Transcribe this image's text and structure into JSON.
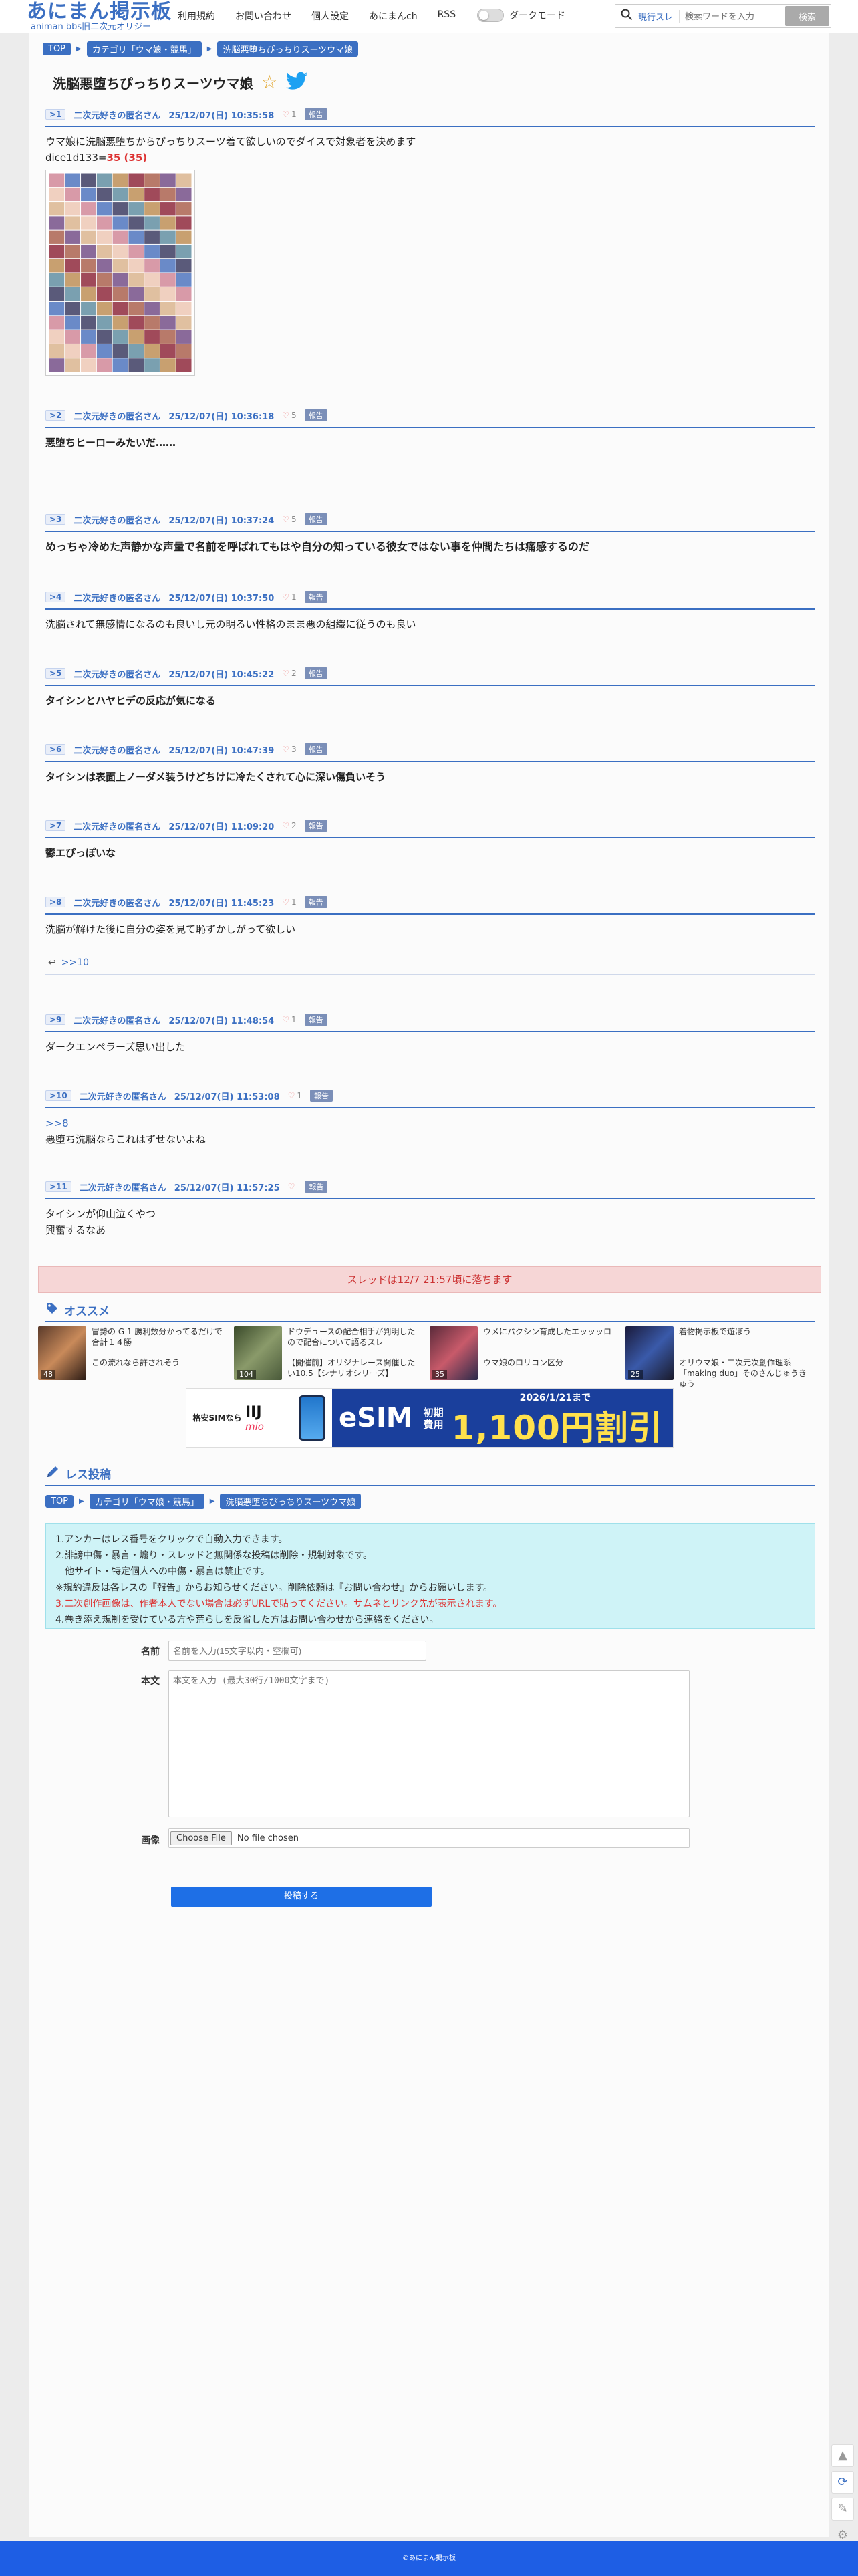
{
  "header": {
    "logo": "あにまん掲示板",
    "logo_sub": "animan bbs旧二次元オリジー",
    "nav": [
      "利用規約",
      "お問い合わせ",
      "個人設定",
      "あにまんch",
      "RSS"
    ],
    "darkmode_label": "ダークモード",
    "search_type": "現行スレ",
    "search_placeholder": "検索ワードを入力",
    "search_button": "検索"
  },
  "breadcrumb": [
    "TOP",
    "カテゴリ「ウマ娘・競馬」",
    "洗脳悪堕ちぴっちりスーツウマ娘"
  ],
  "thread": {
    "title": "洗脳悪堕ちぴっちりスーツウマ娘"
  },
  "report_label": "報告",
  "posts": [
    {
      "num": ">1",
      "name": "二次元好きの匿名さん",
      "date": "25/12/07(日) 10:35:58",
      "likes": "1",
      "lines": [
        "ウマ娘に洗脳悪堕ちからぴっちりスーツ着て欲しいのでダイスで対象者を決めます"
      ],
      "dice_prefix": "dice1d133=",
      "dice_value": "35 (35)"
    },
    {
      "num": ">2",
      "name": "二次元好きの匿名さん",
      "date": "25/12/07(日) 10:36:18",
      "likes": "5",
      "lines": [
        "悪堕ちヒーローみたいだ……"
      ]
    },
    {
      "num": ">3",
      "name": "二次元好きの匿名さん",
      "date": "25/12/07(日) 10:37:24",
      "likes": "5",
      "lines": [
        "めっちゃ冷めた声静かな声量で名前を呼ばれてもはや自分の知っている彼女ではない事を仲間たちは痛感するのだ"
      ]
    },
    {
      "num": ">4",
      "name": "二次元好きの匿名さん",
      "date": "25/12/07(日) 10:37:50",
      "likes": "1",
      "lines": [
        "洗脳されて無感情になるのも良いし元の明るい性格のまま悪の組織に従うのも良い"
      ]
    },
    {
      "num": ">5",
      "name": "二次元好きの匿名さん",
      "date": "25/12/07(日) 10:45:22",
      "likes": "2",
      "lines": [
        "タイシンとハヤヒデの反応が気になる"
      ]
    },
    {
      "num": ">6",
      "name": "二次元好きの匿名さん",
      "date": "25/12/07(日) 10:47:39",
      "likes": "3",
      "lines": [
        "タイシンは表面上ノーダメ装うけどちけに冷たくされて心に深い傷負いそう"
      ]
    },
    {
      "num": ">7",
      "name": "二次元好きの匿名さん",
      "date": "25/12/07(日) 11:09:20",
      "likes": "2",
      "lines": [
        "鬱エぴっぽいな"
      ]
    },
    {
      "num": ">8",
      "name": "二次元好きの匿名さん",
      "date": "25/12/07(日) 11:45:23",
      "likes": "1",
      "lines": [
        "洗脳が解けた後に自分の姿を見て恥ずかしがって欲しい"
      ],
      "reply": ">>10"
    },
    {
      "num": ">9",
      "name": "二次元好きの匿名さん",
      "date": "25/12/07(日) 11:48:54",
      "likes": "1",
      "lines": [
        "ダークエンペラーズ思い出した"
      ]
    },
    {
      "num": ">10",
      "name": "二次元好きの匿名さん",
      "date": "25/12/07(日) 11:53:08",
      "likes": "1",
      "anchor": ">>8",
      "lines": [
        "悪堕ち洗脳ならこれはずせないよね"
      ]
    },
    {
      "num": ">11",
      "name": "二次元好きの匿名さん",
      "date": "25/12/07(日) 11:57:25",
      "likes": "",
      "lines": [
        "タイシンが仰山泣くやつ",
        "興奮するなあ"
      ]
    }
  ],
  "drop_notice": "スレッドは12/7 21:57頃に落ちます",
  "recommend": {
    "title": "オススメ",
    "items": [
      {
        "title": "冒勢の G 1 勝利数分かってるだけで合計１４勝",
        "desc": "この流れなら許されそう",
        "count": "48"
      },
      {
        "title": "ドウデュースの配合相手が判明したので配合について語るスレ",
        "desc": "【開催前】オリジナレース開催したい10.5【シナリオシリーズ】",
        "count": "104"
      },
      {
        "title": "ウメにパクシン育成したエッッッロ",
        "desc": "ウマ娘のロリコン区分",
        "count": "35"
      },
      {
        "title": "着物掲示板で遊ぼう",
        "desc": "オリウマ娘・二次元次創作理系「making duo」そのさんじゅうきゅう",
        "count": "25"
      }
    ]
  },
  "banner": {
    "sub": "格安SIMなら",
    "brand1": "IIJ",
    "brand2": "mio",
    "esim": "eSIM",
    "label": "初期\n費用",
    "price": "1,100円割引",
    "date": "2026/1/21まで"
  },
  "form": {
    "title": "レス投稿",
    "rules": [
      "1.アンカーはレス番号をクリックで自動入力できます。",
      "2.誹謗中傷・暴言・煽り・スレッドと無関係な投稿は削除・規制対象です。",
      "　他サイト・特定個人への中傷・暴言は禁止です。",
      "※規約違反は各レスの『報告』からお知らせください。削除依頼は『お問い合わせ』からお願いします。",
      "3.二次創作画像は、作者本人でない場合は必ずURLで貼ってください。サムネとリンク先が表示されます。",
      "4.巻き添え規制を受けている方や荒らしを反省した方はお問い合わせから連絡をください。"
    ],
    "name_label": "名前",
    "name_placeholder": "名前を入力(15文字以内・空欄可)",
    "body_label": "本文",
    "body_placeholder": "本文を入力 (最大30行/1000文字まで)",
    "image_label": "画像",
    "file_button": "Choose File",
    "file_status": "No file chosen",
    "submit": "投稿する"
  },
  "footer": "©あにまん掲示板",
  "colors": {
    "accent": "#3b6fc2",
    "footer": "#1e5ee4",
    "notice": "#f6d6d6",
    "rules_bg": "#cff3f7"
  }
}
